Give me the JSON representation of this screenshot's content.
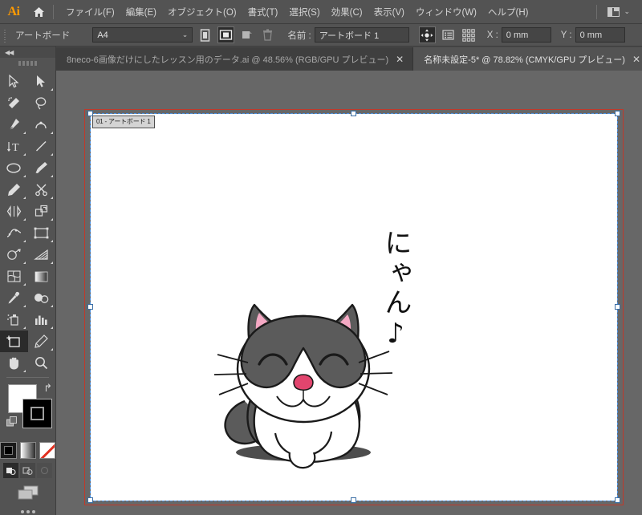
{
  "app": {
    "name": "Ai",
    "logo_color": "#ff9a00"
  },
  "menubar": {
    "home_icon": "home-icon",
    "items": [
      {
        "label": "ファイル(F)"
      },
      {
        "label": "編集(E)"
      },
      {
        "label": "オブジェクト(O)"
      },
      {
        "label": "書式(T)"
      },
      {
        "label": "選択(S)"
      },
      {
        "label": "効果(C)"
      },
      {
        "label": "表示(V)"
      },
      {
        "label": "ウィンドウ(W)"
      },
      {
        "label": "ヘルプ(H)"
      }
    ],
    "workspace_switcher": {
      "icon": "workspace-grid-icon",
      "chevron": "⌄"
    }
  },
  "controlbar": {
    "tool_label": "アートボード",
    "preset_value": "A4",
    "preset_chevron": "⌄",
    "portrait_icon": "portrait-orientation-icon",
    "landscape_icon": "landscape-orientation-icon",
    "new_artboard_icon": "new-artboard-icon",
    "delete_artboard_icon": "trash-icon",
    "name_label": "名前 :",
    "name_value": "アートボード 1",
    "move_artwork_icon": "move-artwork-with-artboard-icon",
    "options_icon": "artboard-options-icon",
    "all_artboards_icon": "all-artboards-icon",
    "x_label": "X :",
    "x_value": "0 mm",
    "y_label": "Y :",
    "y_value": "0 mm"
  },
  "tabs": [
    {
      "title": "8neco-6画像だけにしたレッスン用のデータ.ai @ 48.56% (RGB/GPU プレビュー)",
      "close": "✕",
      "active": false
    },
    {
      "title": "名称未設定-5* @ 78.82% (CMYK/GPU プレビュー)",
      "close": "✕",
      "active": true
    }
  ],
  "toolbar": {
    "collapse_icon": "double-chevron-left-icon",
    "tools": [
      {
        "name": "selection-tool",
        "selected": false
      },
      {
        "name": "direct-selection-tool",
        "selected": false
      },
      {
        "name": "magic-wand-tool",
        "selected": false
      },
      {
        "name": "lasso-tool",
        "selected": false
      },
      {
        "name": "pen-tool",
        "selected": false
      },
      {
        "name": "curvature-tool",
        "selected": false
      },
      {
        "name": "type-tool",
        "selected": false
      },
      {
        "name": "line-segment-tool",
        "selected": false
      },
      {
        "name": "ellipse-tool",
        "selected": false
      },
      {
        "name": "paintbrush-tool",
        "selected": false
      },
      {
        "name": "pencil-tool",
        "selected": false
      },
      {
        "name": "scissors-tool",
        "selected": false
      },
      {
        "name": "rotate-tool",
        "selected": false
      },
      {
        "name": "scale-tool",
        "selected": false
      },
      {
        "name": "width-tool",
        "selected": false
      },
      {
        "name": "free-transform-tool",
        "selected": false
      },
      {
        "name": "shape-builder-tool",
        "selected": false
      },
      {
        "name": "perspective-grid-tool",
        "selected": false
      },
      {
        "name": "mesh-tool",
        "selected": false
      },
      {
        "name": "gradient-tool",
        "selected": false
      },
      {
        "name": "eyedropper-tool",
        "selected": false
      },
      {
        "name": "blend-tool",
        "selected": false
      },
      {
        "name": "symbol-sprayer-tool",
        "selected": false
      },
      {
        "name": "column-graph-tool",
        "selected": false
      },
      {
        "name": "artboard-tool",
        "selected": true
      },
      {
        "name": "slice-tool",
        "selected": false
      },
      {
        "name": "hand-tool",
        "selected": false
      },
      {
        "name": "zoom-tool",
        "selected": false
      }
    ],
    "fill_color": "#ffffff",
    "stroke_color": "#000000",
    "swap_icon": "swap-fill-stroke-icon",
    "default_icon": "default-fill-stroke-icon",
    "color_mode_icon": "color-swatch-icon",
    "gradient_mode_icon": "gradient-swatch-icon",
    "none_mode_icon": "none-swatch-icon",
    "draw_normal_icon": "draw-normal-icon",
    "draw_behind_icon": "draw-behind-icon",
    "draw_inside_icon": "draw-inside-icon",
    "screen_mode_icon": "change-screen-mode-icon",
    "more_icon": "edit-toolbar-icon"
  },
  "canvas": {
    "artboard_label": "01 - アートボード 1",
    "artboard_fill": "#ffffff",
    "bleed_color": "#c0392b",
    "boundary_color": "#4a90e2"
  },
  "artwork": {
    "name": "cat-illustration",
    "text": "にゃん♪",
    "colors": {
      "fur_gray": "#5b5b5b",
      "fur_white": "#ffffff",
      "ear_pink": "#f5a9c4",
      "nose_pink": "#e2456e",
      "outline": "#1a1a1a",
      "shadow": "#4d4d4d"
    }
  }
}
